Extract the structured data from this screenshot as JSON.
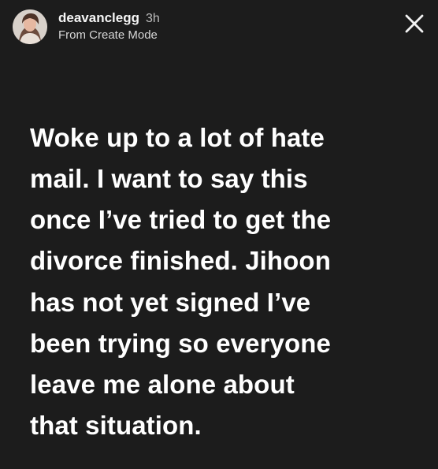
{
  "story": {
    "username": "deavanclegg",
    "time": "3h",
    "subtitle": "From Create Mode",
    "avatar": "profile-avatar",
    "close_icon": "close-icon",
    "text_lines": [
      "Woke up to a lot of hate",
      "mail. I want to say this",
      "once I’ve tried to get the",
      "divorce finished. Jihoon",
      "has not yet signed I’ve",
      "been trying so everyone",
      "leave me alone about",
      "that situation."
    ],
    "colors": {
      "background": "#1c1c1c",
      "primary_text": "#ffffff",
      "secondary_text": "#bdbdbd"
    }
  }
}
